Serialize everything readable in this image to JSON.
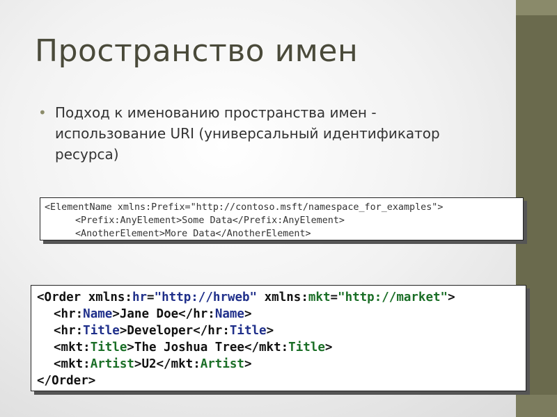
{
  "slide": {
    "title": "Пространство имен",
    "bullet": {
      "text": "Подход к именованию пространства имен  - использование URI (универсальный идентификатор ресурса)"
    }
  },
  "example1": {
    "lines": [
      "<ElementName xmlns:Prefix=\"http://contoso.msft/namespace_for_examples\">",
      "<Prefix:AnyElement>Some Data</Prefix:AnyElement>",
      "<AnotherElement>More Data</AnotherElement>"
    ]
  },
  "example2": {
    "line1": {
      "p1": "<Order xmlns:",
      "p2": "hr",
      "p3": "=",
      "p4": "\"http://hrweb\"",
      "p5": " xmlns:",
      "p6": "mkt",
      "p7": "=",
      "p8": "\"http://market\"",
      "p9": ">"
    },
    "line2": {
      "p1": "<hr:",
      "p2": "Name",
      "p3": ">Jane Doe</hr:",
      "p4": "Name",
      "p5": ">"
    },
    "line3": {
      "p1": "<hr:",
      "p2": "Title",
      "p3": ">Developer</hr:",
      "p4": "Title",
      "p5": ">"
    },
    "line4": {
      "p1": "<mkt:",
      "p2": "Title",
      "p3": ">The Joshua Tree</mkt:",
      "p4": "Title",
      "p5": ">"
    },
    "line5": {
      "p1": "<mkt:",
      "p2": "Artist",
      "p3": ">U2</mkt:",
      "p4": "Artist",
      "p5": ">"
    },
    "line6": {
      "p1": "</Order>"
    }
  },
  "colors": {
    "side_bar": "#6a6a4d",
    "title": "#4a4a3a",
    "namespace_hr": "#1f2f8a",
    "namespace_mkt": "#1a6e26"
  }
}
